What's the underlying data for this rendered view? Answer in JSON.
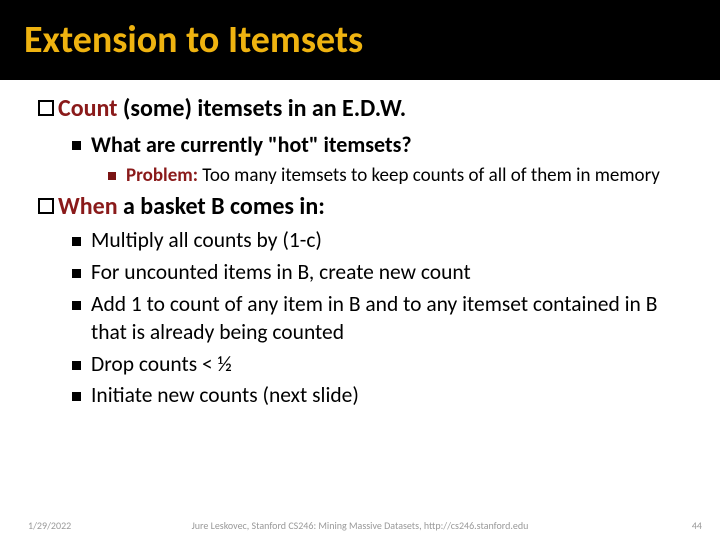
{
  "title": "Extension to Itemsets",
  "point1": {
    "prefix": "Count",
    "rest": " (some) itemsets in an E.D.W."
  },
  "sub1": "What are currently \"hot\" itemsets?",
  "sub2": {
    "label": "Problem:",
    "rest": " Too many itemsets to keep counts of all of them in memory"
  },
  "point2": {
    "prefix": "When",
    "rest": " a basket B comes in:"
  },
  "items": {
    "a": "Multiply all counts by (1-c)",
    "b": "For uncounted items in B, create new count",
    "c": "Add 1 to count of any item in B  and to any itemset contained in B that is already being counted",
    "d": "Drop counts < ½",
    "e": "Initiate new counts (next slide)"
  },
  "footer": {
    "date": "1/29/2022",
    "credit": "Jure Leskovec, Stanford CS246: Mining Massive Datasets, http://cs246.stanford.edu",
    "page": "44"
  }
}
